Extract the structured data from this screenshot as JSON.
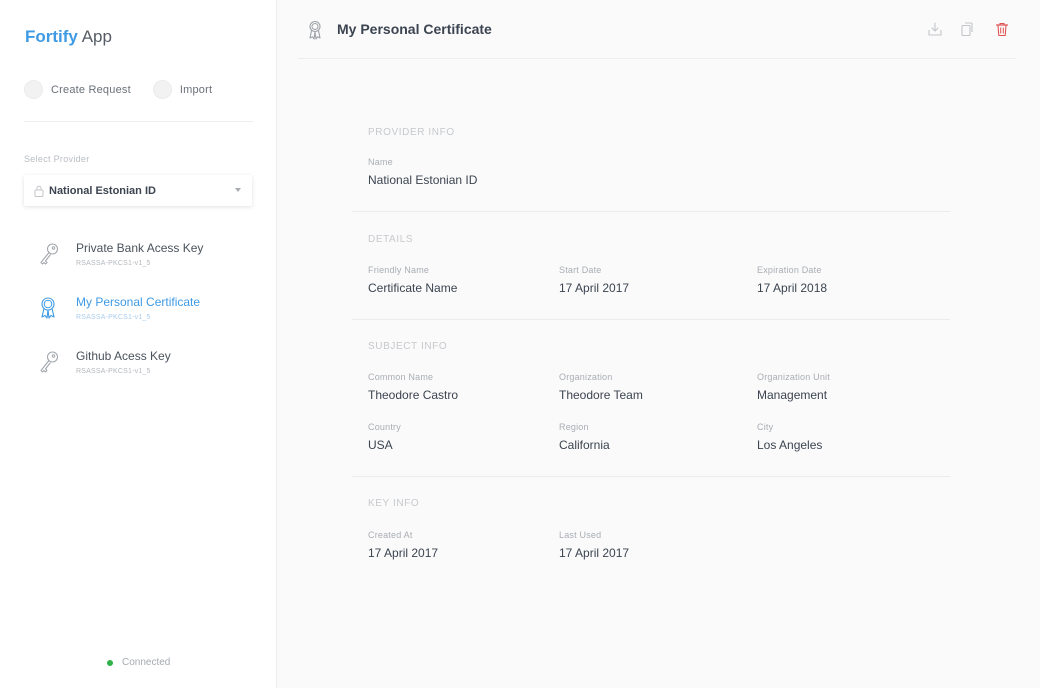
{
  "app": {
    "brand": "Fortify",
    "name": "App"
  },
  "actions": {
    "create_request": "Create Request",
    "import": "Import"
  },
  "provider": {
    "label": "Select Provider",
    "selected": "National Estonian ID"
  },
  "keys": [
    {
      "name": "Private Bank Acess Key",
      "algorithm": "RSASSA-PKCS1-v1_5",
      "icon": "key-icon"
    },
    {
      "name": "My Personal Certificate",
      "algorithm": "RSASSA-PKCS1-v1_5",
      "icon": "certificate-icon",
      "active": true
    },
    {
      "name": "Github Acess Key",
      "algorithm": "RSASSA-PKCS1-v1_5",
      "icon": "key-icon"
    }
  ],
  "status": {
    "text": "Connected",
    "color": "#2fb24a"
  },
  "header": {
    "title": "My Personal Certificate",
    "icons": [
      "download-icon",
      "copy-icon",
      "delete-icon"
    ]
  },
  "sections": {
    "provider_info": {
      "title": "PROVIDER INFO",
      "name_label": "Name",
      "name_value": "National Estonian ID"
    },
    "details": {
      "title": "DETAILS",
      "friendly_label": "Friendly Name",
      "friendly_value": "Certificate Name",
      "start_label": "Start Date",
      "start_value": "17 April 2017",
      "exp_label": "Expiration Date",
      "exp_value": "17 April 2018"
    },
    "subject_info": {
      "title": "SUBJECT INFO",
      "cn_label": "Common Name",
      "cn_value": "Theodore Castro",
      "org_label": "Organization",
      "org_value": "Theodore Team",
      "ou_label": "Organization Unit",
      "ou_value": "Management",
      "country_label": "Country",
      "country_value": "USA",
      "region_label": "Region",
      "region_value": "California",
      "city_label": "City",
      "city_value": "Los Angeles"
    },
    "key_info": {
      "title": "KEY INFO",
      "created_label": "Created At",
      "created_value": "17 April 2017",
      "used_label": "Last Used",
      "used_value": "17 April 2017"
    }
  },
  "colors": {
    "accent": "#3f9ae4",
    "danger": "#e05353",
    "connected": "#2fb24a"
  }
}
